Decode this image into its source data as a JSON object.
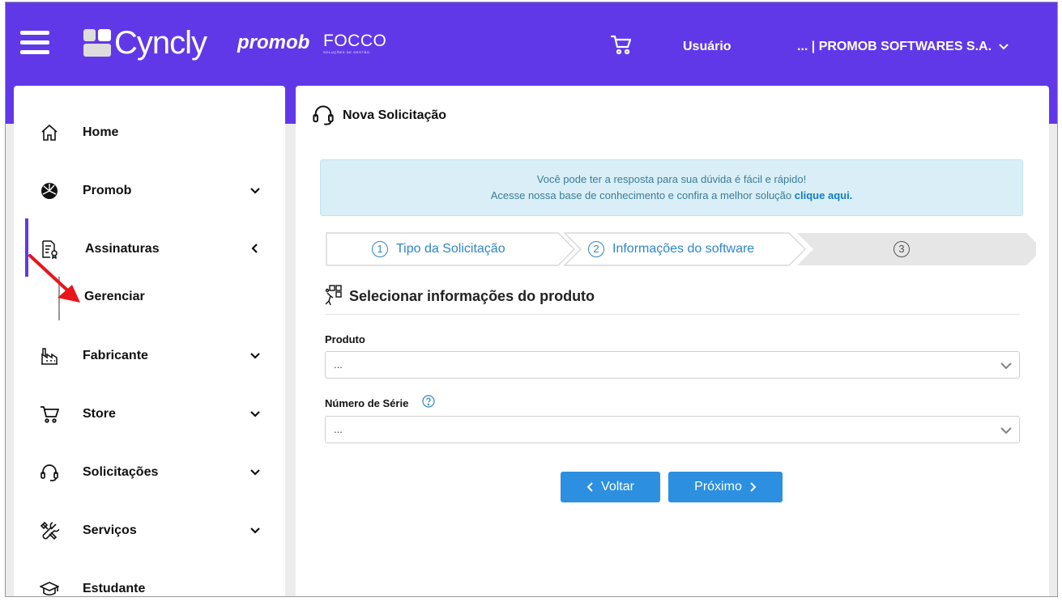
{
  "header": {
    "brand": "Cyncly",
    "partner_brand": "promob",
    "partner_brand_2": "FOCCO",
    "partner_brand_2_sub": "SOLUÇÕES DE GESTÃO",
    "user_label": "Usuário",
    "company_label": "... | PROMOB SOFTWARES S.A."
  },
  "sidebar": {
    "items": [
      {
        "label": "Home",
        "icon": "home-icon"
      },
      {
        "label": "Promob",
        "icon": "promob-icon"
      },
      {
        "label": "Assinaturas",
        "icon": "subscription-icon",
        "expanded": true
      },
      {
        "label": "Fabricante",
        "icon": "factory-icon"
      },
      {
        "label": "Store",
        "icon": "cart-icon"
      },
      {
        "label": "Solicitações",
        "icon": "headset-icon"
      },
      {
        "label": "Serviços",
        "icon": "tools-icon"
      },
      {
        "label": "Estudante",
        "icon": "graduation-cap-icon"
      }
    ],
    "subitem": "Gerenciar"
  },
  "main": {
    "title": "Nova Solicitação",
    "info_line1": "Você pode ter a resposta para sua dúvida é fácil e rápido!",
    "info_line2": "Acesse nossa base de conhecimento e confira a melhor solução",
    "info_link": "clique aqui.",
    "steps": [
      {
        "number": "1",
        "label": "Tipo da Solicitação"
      },
      {
        "number": "2",
        "label": "Informações do software"
      },
      {
        "number": "3",
        "label": ""
      }
    ],
    "section_title": "Selecionar informações do produto",
    "produto_label": "Produto",
    "produto_value": "...",
    "serie_label": "Número de Série",
    "serie_value": "...",
    "back_label": "Voltar",
    "next_label": "Próximo"
  },
  "colors": {
    "primary": "#6138e8",
    "button": "#2c8fe0",
    "info_bg": "#d9eef6",
    "step_active": "#2f86c9",
    "annotation": "#e8151b"
  }
}
